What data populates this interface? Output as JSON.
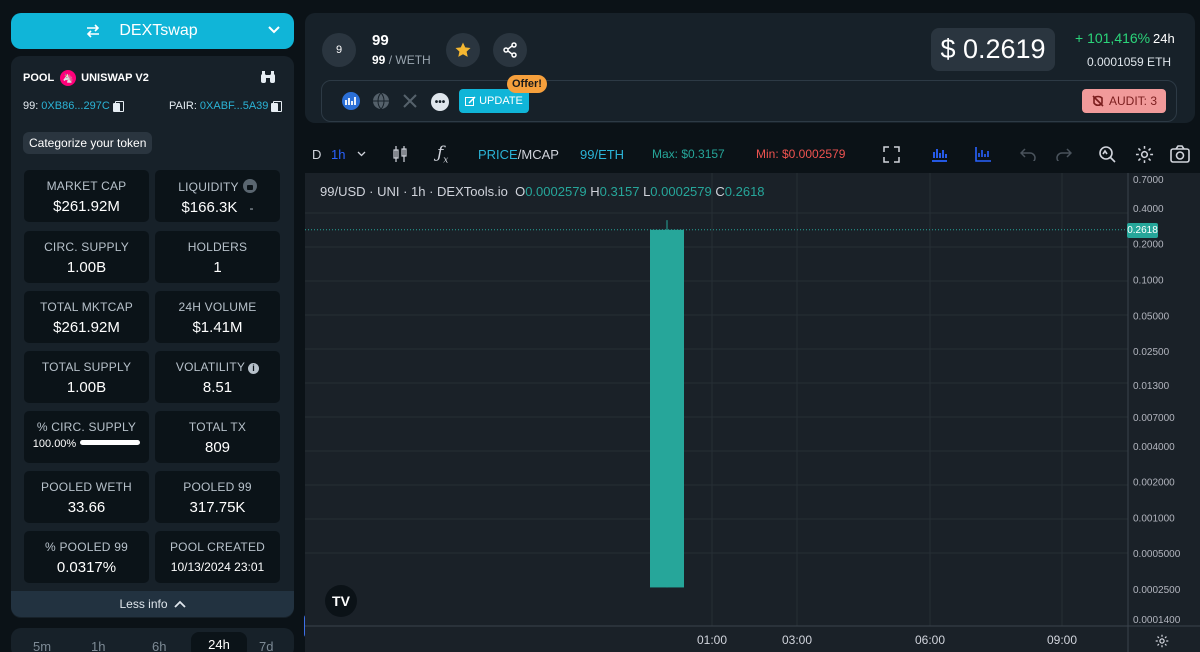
{
  "header": {
    "dex_label": "DEXTswap"
  },
  "pool": {
    "label": "POOL",
    "exchange": "UNISWAP V2",
    "token_key": "99:",
    "token_addr": "0XB86...297C",
    "pair_key": "PAIR:",
    "pair_addr": "0XABF...5A39",
    "categorize": "Categorize your token"
  },
  "stats": [
    {
      "label": "MARKET CAP",
      "value": "$261.92M"
    },
    {
      "label": "LIQUIDITY",
      "value": "$166.3K",
      "extra": "-"
    },
    {
      "label": "CIRC. SUPPLY",
      "value": "1.00B"
    },
    {
      "label": "HOLDERS",
      "value": "1"
    },
    {
      "label": "TOTAL MKTCAP",
      "value": "$261.92M"
    },
    {
      "label": "24H VOLUME",
      "value": "$1.41M"
    },
    {
      "label": "TOTAL SUPPLY",
      "value": "1.00B"
    },
    {
      "label": "VOLATILITY",
      "value": "8.51"
    },
    {
      "label": "% CIRC. SUPPLY",
      "value": "100.00%",
      "fill": 1.0
    },
    {
      "label": "TOTAL TX",
      "value": "809"
    },
    {
      "label": "POOLED WETH",
      "value": "33.66"
    },
    {
      "label": "POOLED 99",
      "value": "317.75K"
    },
    {
      "label": "% POOLED 99",
      "value": "0.0317%"
    },
    {
      "label": "POOL CREATED",
      "value": "10/13/2024 23:01"
    }
  ],
  "less_info": "Less info",
  "timeframes": [
    "5m",
    "1h",
    "6h",
    "24h",
    "7d"
  ],
  "timeframe_active": "24h",
  "token": {
    "avatar": "9",
    "name": "99",
    "pair_base": "99",
    "pair_quote": "/ WETH"
  },
  "price": {
    "usd": "$ 0.2619",
    "change": "+ 101,416%",
    "period": "24h",
    "eth": "0.0001059 ETH"
  },
  "links": {
    "update": "UPDATE",
    "offer": "Offer!",
    "audit": "AUDIT: 3"
  },
  "toolbar": {
    "d": "D",
    "interval": "1h",
    "price_mcap_a": "PRICE",
    "price_mcap_sep": "/",
    "price_mcap_b": "MCAP",
    "pair": "99/ETH",
    "max": "Max: $0.3157",
    "min": "Min: $0.0002579"
  },
  "legend": {
    "title": "99/USD · UNI · 1h · DEXTools.io",
    "o_key": "O",
    "o": "0.0002579",
    "h_key": "H",
    "h": "0.3157",
    "l_key": "L",
    "l": "0.0002579",
    "c_key": "C",
    "c": "0.2618"
  },
  "chart_data": {
    "type": "candlestick",
    "scale": "log",
    "price_axis": [
      "0.7000",
      "0.4000",
      "0.2000",
      "0.1000",
      "0.05000",
      "0.02500",
      "0.01300",
      "0.007000",
      "0.004000",
      "0.002000",
      "0.001000",
      "0.0005000",
      "0.0002500",
      "0.0001400"
    ],
    "time_axis": [
      "01:00",
      "03:00",
      "06:00",
      "09:00"
    ],
    "current_price_label": "0.2618",
    "candles": [
      {
        "time": "00:00",
        "open": 0.0002579,
        "high": 0.3157,
        "low": 0.0002579,
        "close": 0.2618
      }
    ],
    "colors": {
      "up": "#26a69a",
      "down": "#ef5350"
    }
  }
}
